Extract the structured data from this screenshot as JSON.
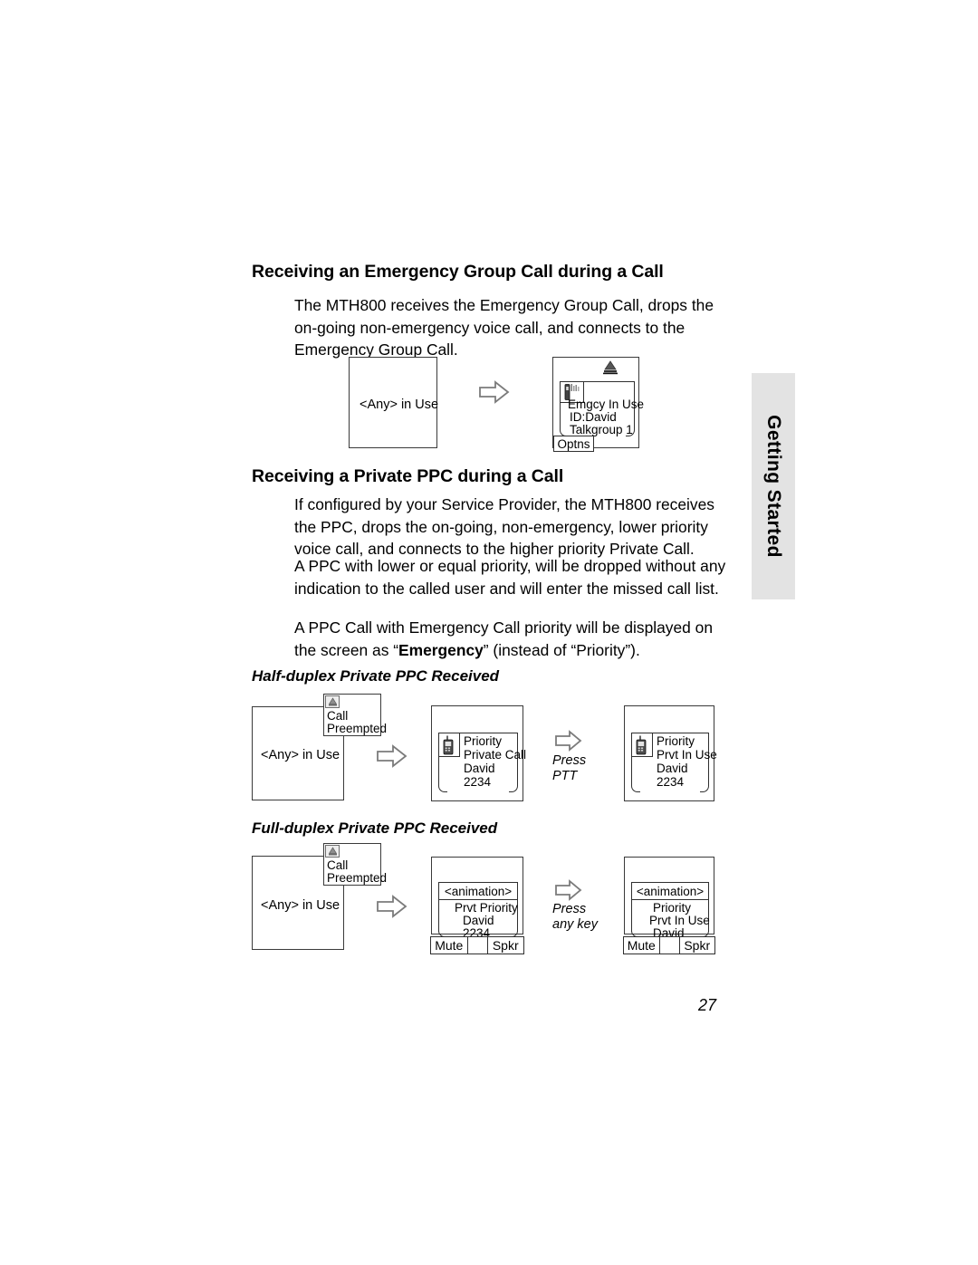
{
  "page": {
    "number": "27",
    "side_tab_label": "Getting Started"
  },
  "sections": [
    {
      "heading": "Receiving an Emergency Group Call during a Call",
      "paragraphs": [
        "The MTH800 receives the Emergency Group Call, drops the on-going non-emergency voice call, and connects to the Emergency Group Call."
      ]
    },
    {
      "heading": "Receiving a Private PPC during a Call",
      "paragraphs": [
        "If configured by your Service Provider, the MTH800 receives the PPC, drops the on-going, non-emergency, lower priority voice call, and connects to the higher priority Private Call.",
        "A PPC with lower or equal priority, will be dropped without any indication to the called user and will enter the missed call list."
      ],
      "paragraph_rich": {
        "before": "A PPC Call with Emergency Call priority will be displayed on the screen as “",
        "bold": "Emergency",
        "after": "” (instead of “Priority”)."
      }
    }
  ],
  "sub_headings": {
    "half_duplex": "Half-duplex Private PPC Received",
    "full_duplex": "Full-duplex Private PPC Received"
  },
  "diagram_emergency": {
    "screen1": {
      "label": "<Any> in Use"
    },
    "screen2": {
      "lines": [
        "Emgcy In Use",
        "ID:David",
        "Talkgroup 1"
      ],
      "softkey": "Optns",
      "icons": [
        "emergency-alert-icon",
        "radio-group-icon"
      ]
    }
  },
  "diagram_half_duplex": {
    "screen1": {
      "label": "<Any> in Use",
      "popup": [
        "Call",
        "Preempted"
      ],
      "popup_icon": "alert-icon"
    },
    "screen2": {
      "lines": [
        "Priority",
        "Private Call",
        "David",
        "2234"
      ],
      "icon": "radio-icon"
    },
    "transition": [
      "Press",
      "PTT"
    ],
    "screen3": {
      "lines": [
        "Priority",
        "Prvt In Use",
        "David",
        "2234"
      ],
      "icon": "radio-icon"
    }
  },
  "diagram_full_duplex": {
    "screen1": {
      "label": "<Any> in Use",
      "popup": [
        "Call",
        "Preempted"
      ],
      "popup_icon": "alert-icon"
    },
    "screen2": {
      "animation": "<animation>",
      "lines": [
        "Prvt Priority",
        "David",
        "2234"
      ],
      "softkeys": [
        "Mute",
        "",
        "Spkr"
      ]
    },
    "transition": [
      "Press",
      "any key"
    ],
    "screen3": {
      "animation": "<animation>",
      "lines": [
        "Priority",
        "Prvt In Use",
        "David"
      ],
      "softkeys": [
        "Mute",
        "",
        "Spkr"
      ]
    }
  },
  "colors": {
    "tab_background": "#e3e3e3",
    "line": "#3a3a3a",
    "text": "#000000"
  }
}
